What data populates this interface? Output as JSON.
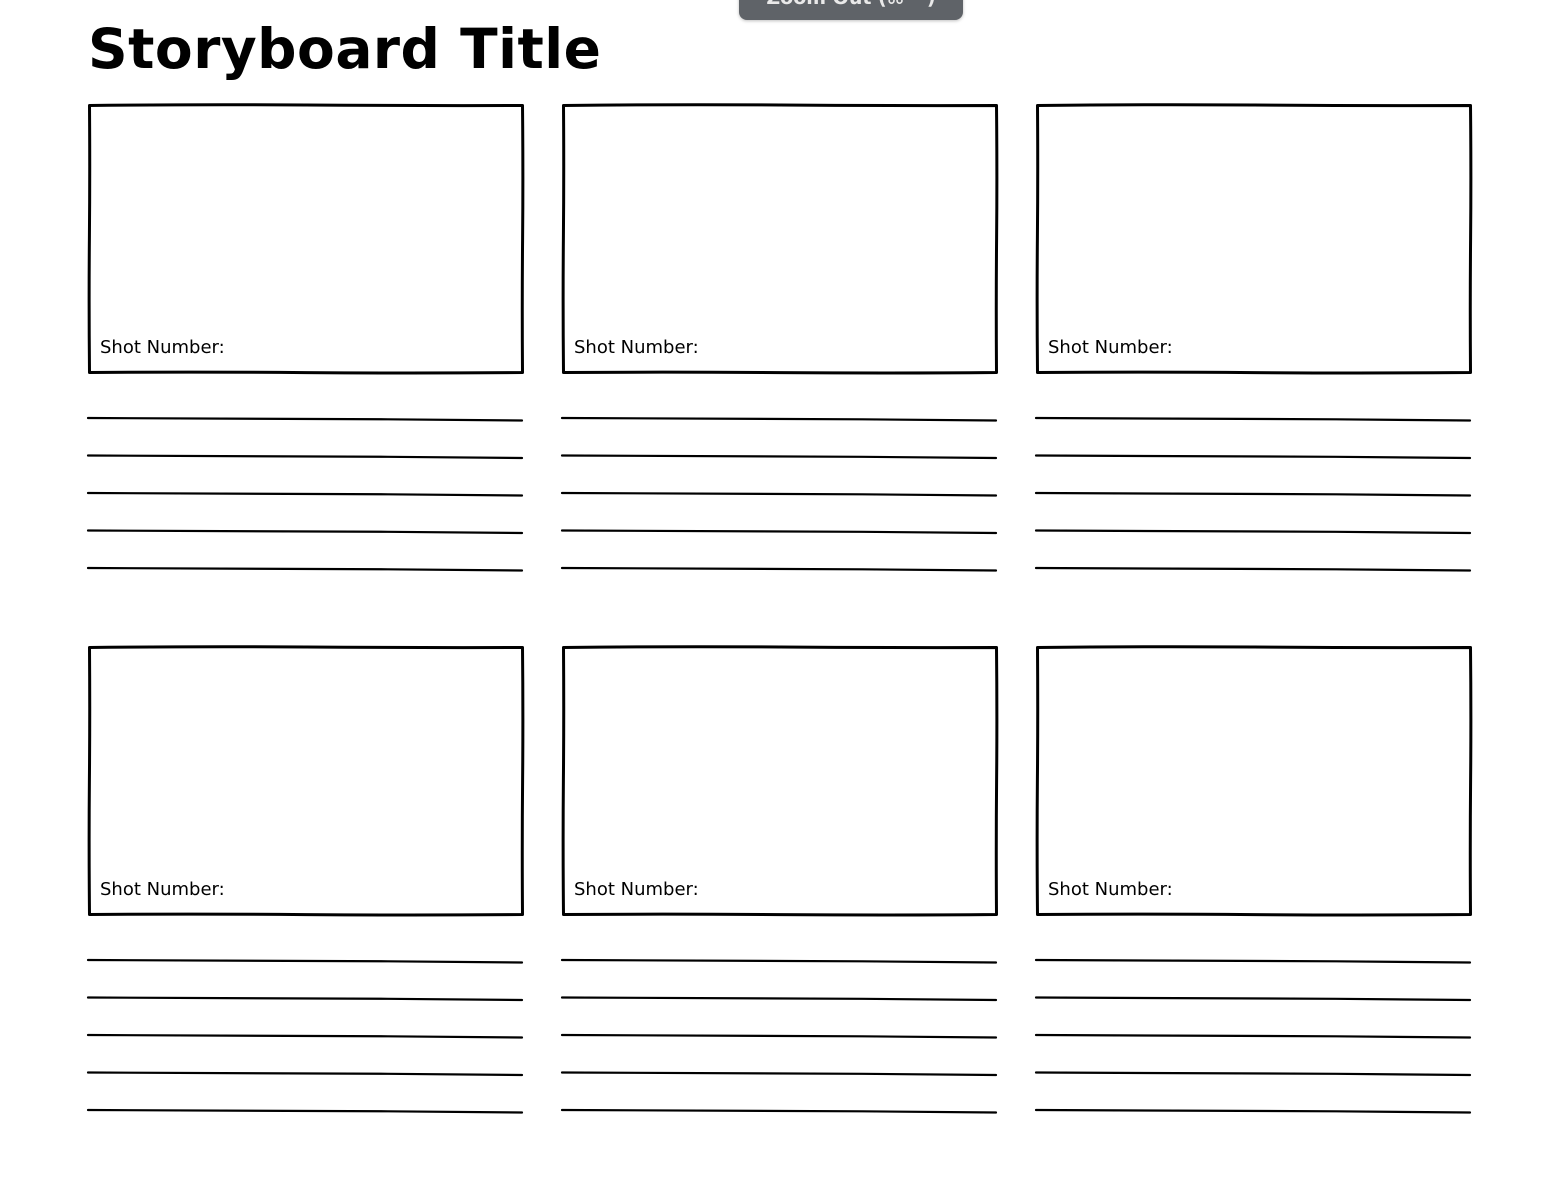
{
  "tooltip": {
    "text": "Zoom Out (⌘ −)"
  },
  "page": {
    "title": "Storyboard Title"
  },
  "shots": [
    {
      "label": "Shot Number:"
    },
    {
      "label": "Shot Number:"
    },
    {
      "label": "Shot Number:"
    },
    {
      "label": "Shot Number:"
    },
    {
      "label": "Shot Number:"
    },
    {
      "label": "Shot Number:"
    }
  ],
  "colors": {
    "ink": "#000000",
    "tooltip_bg": "#5f6368",
    "background": "#ffffff"
  }
}
